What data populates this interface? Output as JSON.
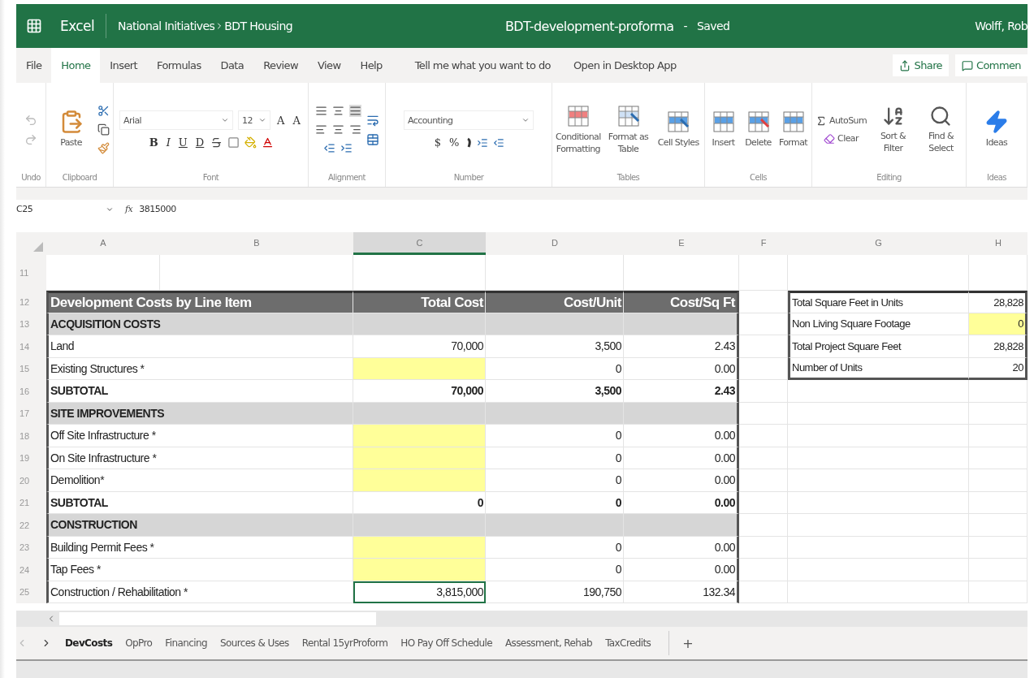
{
  "header": {
    "app": "Excel",
    "breadcrumb": [
      "National Initiatives",
      "BDT Housing"
    ],
    "title": "BDT-development-proforma",
    "separator": "-",
    "status": "Saved",
    "user": "Wolff, Rob"
  },
  "menu": {
    "tabs": [
      {
        "label": "File",
        "selected": false
      },
      {
        "label": "Home",
        "selected": true
      },
      {
        "label": "Insert",
        "selected": false
      },
      {
        "label": "Formulas",
        "selected": false
      },
      {
        "label": "Data",
        "selected": false
      },
      {
        "label": "Review",
        "selected": false
      },
      {
        "label": "View",
        "selected": false
      },
      {
        "label": "Help",
        "selected": false
      }
    ],
    "tell_me": "Tell me what you want to do",
    "open_desktop": "Open in Desktop App",
    "share": "Share",
    "comments": "Commen"
  },
  "ribbon": {
    "groups": [
      {
        "kind": "undo",
        "label": "Undo"
      },
      {
        "kind": "clipboard",
        "label": "Clipboard",
        "paste": "Paste"
      },
      {
        "kind": "font",
        "label": "Font",
        "font": "Arial",
        "size": "12",
        "grow": "A",
        "shrink": "A",
        "styles": [
          "B",
          "I",
          "U",
          "D"
        ]
      },
      {
        "kind": "alignment",
        "label": "Alignment"
      },
      {
        "kind": "number",
        "label": "Number",
        "format": "Accounting",
        "currency": "$",
        "percent": "%"
      },
      {
        "kind": "tables",
        "label": "Tables",
        "buttons": [
          "Conditional Formatting",
          "Format as Table",
          "Cell Styles"
        ]
      },
      {
        "kind": "cells",
        "label": "Cells",
        "buttons": [
          "Insert",
          "Delete",
          "Format"
        ]
      },
      {
        "kind": "editing",
        "label": "Editing",
        "autosum": "AutoSum",
        "clear": "Clear",
        "buttons": [
          "Sort & Filter",
          "Find & Select"
        ]
      },
      {
        "kind": "ideas",
        "label": "Ideas",
        "buttons": [
          "Ideas"
        ]
      }
    ]
  },
  "formula_bar": {
    "name_box": "C25",
    "function_label": "fx",
    "value": "3815000"
  },
  "table": {
    "columns": [
      {
        "label": "A",
        "selected": false
      },
      {
        "label": "B",
        "selected": false
      },
      {
        "label": "C",
        "selected": true
      },
      {
        "label": "D",
        "selected": false
      },
      {
        "label": "E",
        "selected": false
      },
      {
        "label": "F",
        "selected": false
      },
      {
        "label": "G",
        "selected": false
      },
      {
        "label": "H",
        "selected": false
      }
    ],
    "rows": [
      {
        "number": "11",
        "kind": "blank"
      },
      {
        "number": "12",
        "kind": "header",
        "label": "Development Costs by Line Item",
        "total": "Total Cost",
        "unit": "Cost/Unit",
        "sqft": "Cost/Sq Ft",
        "side": {
          "label": "Total Square Feet in Units",
          "value": "28,828",
          "input": false
        }
      },
      {
        "number": "13",
        "kind": "section",
        "label": "ACQUISITION COSTS",
        "side": {
          "label": "Non Living Square Footage",
          "value": "0",
          "input": true
        }
      },
      {
        "number": "14",
        "kind": "item",
        "label": "Land",
        "total": "70,000",
        "unit": "3,500",
        "sqft": "2.43",
        "input": false,
        "selected": false,
        "side": {
          "label": "Total Project Square Feet",
          "value": "28,828",
          "input": false
        }
      },
      {
        "number": "15",
        "kind": "item",
        "label": "Existing Structures *",
        "unit": "0",
        "sqft": "0.00",
        "input": true,
        "selected": false,
        "side": {
          "label": "Number of Units",
          "value": "20",
          "input": false
        }
      },
      {
        "number": "16",
        "kind": "subtotal",
        "label": "SUBTOTAL",
        "total": "70,000",
        "unit": "3,500",
        "sqft": "2.43"
      },
      {
        "number": "17",
        "kind": "section",
        "label": "SITE IMPROVEMENTS"
      },
      {
        "number": "18",
        "kind": "item",
        "label": "Off Site Infrastructure *",
        "unit": "0",
        "sqft": "0.00",
        "input": true,
        "selected": false
      },
      {
        "number": "19",
        "kind": "item",
        "label": "On Site Infrastructure *",
        "unit": "0",
        "sqft": "0.00",
        "input": true,
        "selected": false
      },
      {
        "number": "20",
        "kind": "item",
        "label": "Demolition*",
        "unit": "0",
        "sqft": "0.00",
        "input": true,
        "selected": false
      },
      {
        "number": "21",
        "kind": "subtotal",
        "label": "SUBTOTAL",
        "total": "0",
        "unit": "0",
        "sqft": "0.00"
      },
      {
        "number": "22",
        "kind": "section",
        "label": "CONSTRUCTION"
      },
      {
        "number": "23",
        "kind": "item",
        "label": "Building Permit Fees *",
        "unit": "0",
        "sqft": "0.00",
        "input": true,
        "selected": false
      },
      {
        "number": "24",
        "kind": "item",
        "label": "Tap Fees *",
        "unit": "0",
        "sqft": "0.00",
        "input": true,
        "selected": false
      },
      {
        "number": "25",
        "kind": "item",
        "label": "Construction  / Rehabilitation *",
        "total": "3,815,000",
        "unit": "190,750",
        "sqft": "132.34",
        "input": false,
        "selected": true
      }
    ]
  },
  "sheets": {
    "tabs": [
      {
        "label": "DevCosts",
        "selected": true
      },
      {
        "label": "OpPro",
        "selected": false
      },
      {
        "label": "Financing",
        "selected": false
      },
      {
        "label": "Sources & Uses",
        "selected": false
      },
      {
        "label": "Rental 15yrProform",
        "selected": false
      },
      {
        "label": "HO Pay Off Schedule",
        "selected": false
      },
      {
        "label": "Assessment, Rehab",
        "selected": false
      },
      {
        "label": "TaxCredits",
        "selected": false
      }
    ],
    "add": "+"
  }
}
